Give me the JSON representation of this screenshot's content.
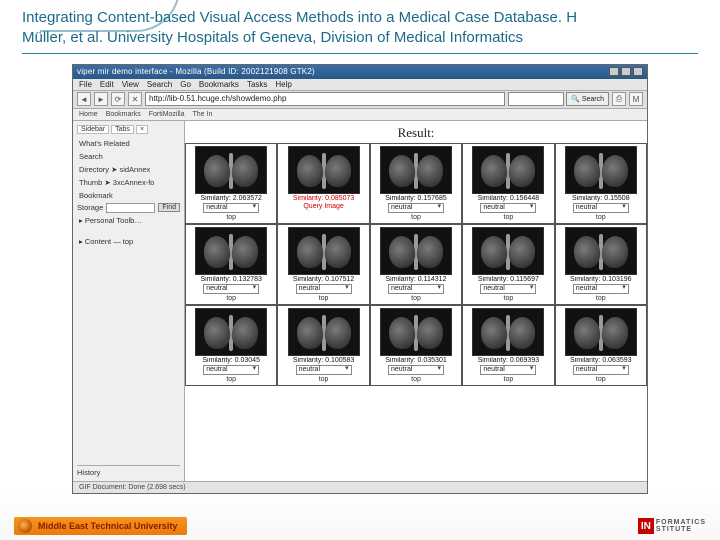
{
  "title": {
    "line1": "Integrating Content-based Visual Access Methods into a Medical Case Database. H",
    "line2": "Müller, et al. University Hospitals of Geneva, Division of Medical Informatics"
  },
  "browser": {
    "window_title": "viper mir demo interface - Mozilla (Build ID: 2002121908 GTK2)",
    "menu": [
      "File",
      "Edit",
      "View",
      "Search",
      "Go",
      "Bookmarks",
      "Tasks",
      "Help"
    ],
    "url": "http://lib-0.51.hcuge.ch/showdemo.php",
    "search_button": "Search",
    "bookmarks": [
      "Home",
      "Bookmarks",
      "FortiMozilla",
      "The In"
    ],
    "status": "GIF  Document: Done (2.698 secs)"
  },
  "sidebar": {
    "tabs": [
      "Sidebar",
      "Tabs"
    ],
    "items": [
      "What's Related",
      "Search",
      "Directory ➤ sidAnnex",
      "Thumb ➤ 3xcAnnex-fo",
      "Bookmark"
    ],
    "storage_label": "Storage",
    "find_button": "Find",
    "tree_root": "▸ Personal Toolb…",
    "content_item": "▸ Content — top",
    "history": "History"
  },
  "content": {
    "heading": "Result:",
    "rows": [
      [
        {
          "sim": "Similarity: 2.063572",
          "sel": "neutral",
          "anno": "top",
          "q": false
        },
        {
          "sim": "Similarity: 0.085073",
          "sel": "",
          "anno": "Query Image",
          "q": true
        },
        {
          "sim": "Similarity: 0.157685",
          "sel": "neutral",
          "anno": "top",
          "q": false
        },
        {
          "sim": "Similarity: 0.156448",
          "sel": "neutral",
          "anno": "top",
          "q": false
        },
        {
          "sim": "Similarity: 0.15508",
          "sel": "neutral",
          "anno": "top",
          "q": false
        }
      ],
      [
        {
          "sim": "Similarity: 0.132783",
          "sel": "neutral",
          "anno": "top",
          "q": false
        },
        {
          "sim": "Similarity: 0.107512",
          "sel": "neutral",
          "anno": "top",
          "q": false
        },
        {
          "sim": "Similarity: 0.114312",
          "sel": "neutral",
          "anno": "top",
          "q": false
        },
        {
          "sim": "Similarity: 0.115697",
          "sel": "neutral",
          "anno": "top",
          "q": false
        },
        {
          "sim": "Similarity: 0.103196",
          "sel": "neutral",
          "anno": "top",
          "q": false
        }
      ],
      [
        {
          "sim": "Similarity: 0.03045",
          "sel": "neutral",
          "anno": "top",
          "q": false
        },
        {
          "sim": "Similarity: 0.100583",
          "sel": "neutral",
          "anno": "top",
          "q": false
        },
        {
          "sim": "Similarity: 0.035301",
          "sel": "neutral",
          "anno": "top",
          "q": false
        },
        {
          "sim": "Similarity: 0.069393",
          "sel": "neutral",
          "anno": "top",
          "q": false
        },
        {
          "sim": "Similarity: 0.063593",
          "sel": "neutral",
          "anno": "top",
          "q": false
        }
      ]
    ]
  },
  "footer": {
    "left": "Middle East Technical University",
    "right_big": "IN",
    "right_small1": "FORMATICS",
    "right_small2": "STITUTE"
  }
}
